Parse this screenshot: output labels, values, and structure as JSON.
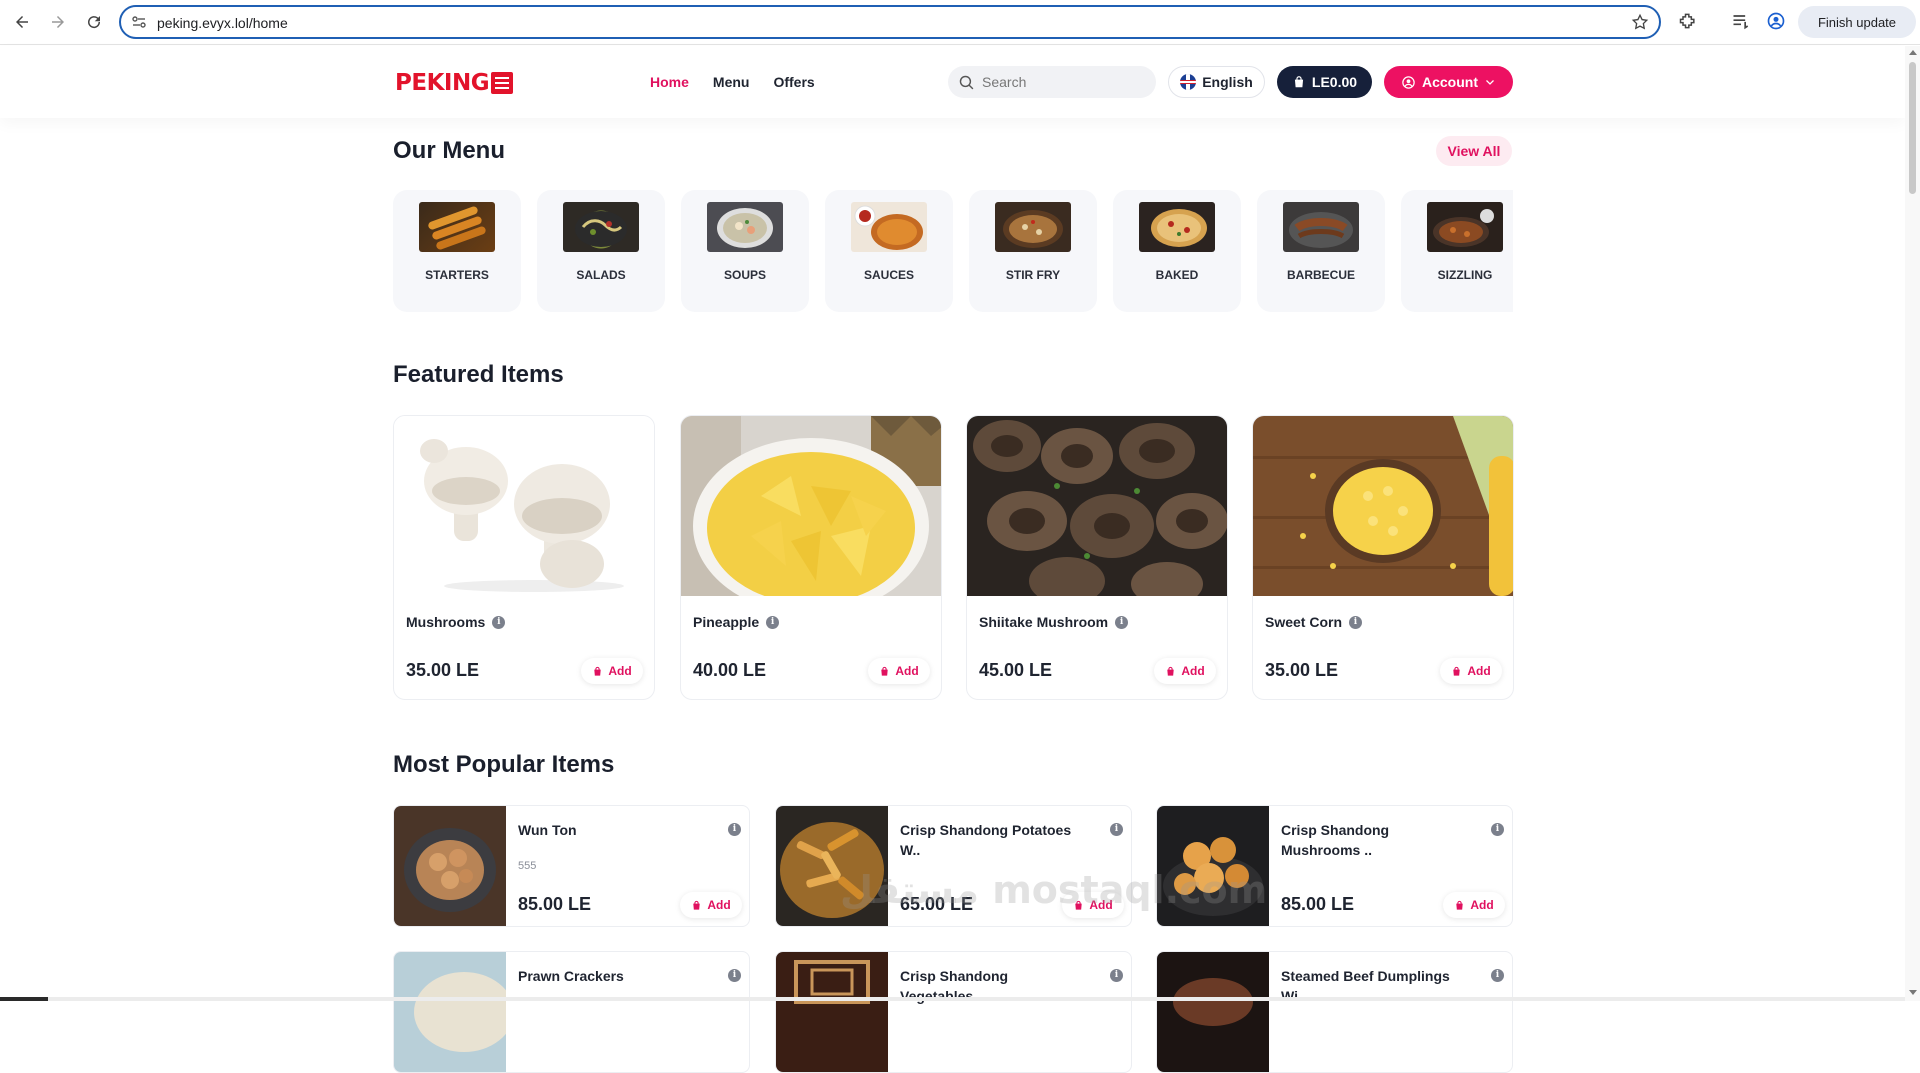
{
  "browser": {
    "url": "peking.evyx.lol/home",
    "finish_update": "Finish update"
  },
  "header": {
    "logo_text": "PEKING",
    "nav": [
      {
        "label": "Home",
        "active": true
      },
      {
        "label": "Menu",
        "active": false
      },
      {
        "label": "Offers",
        "active": false
      }
    ],
    "search_placeholder": "Search",
    "language": "English",
    "cart_total": "LE0.00",
    "account_label": "Account"
  },
  "menu_section": {
    "title": "Our Menu",
    "view_all": "View All",
    "categories": [
      "STARTERS",
      "SALADS",
      "SOUPS",
      "SAUCES",
      "STIR FRY",
      "BAKED",
      "BARBECUE",
      "SIZZLING"
    ]
  },
  "featured": {
    "title": "Featured Items",
    "items": [
      {
        "name": "Mushrooms",
        "price": "35.00 LE",
        "add": "Add"
      },
      {
        "name": "Pineapple",
        "price": "40.00 LE",
        "add": "Add"
      },
      {
        "name": "Shiitake Mushroom",
        "price": "45.00 LE",
        "add": "Add"
      },
      {
        "name": "Sweet Corn",
        "price": "35.00 LE",
        "add": "Add"
      }
    ]
  },
  "popular": {
    "title": "Most Popular Items",
    "items": [
      {
        "name": "Wun Ton",
        "desc": "555",
        "price": "85.00 LE",
        "add": "Add"
      },
      {
        "name": "Crisp Shandong Potatoes W..",
        "desc": "",
        "price": "65.00 LE",
        "add": "Add"
      },
      {
        "name": "Crisp Shandong Mushrooms ..",
        "desc": "",
        "price": "85.00 LE",
        "add": "Add"
      },
      {
        "name": "Prawn Crackers",
        "desc": "",
        "price": "",
        "add": ""
      },
      {
        "name": "Crisp Shandong Vegetables..",
        "desc": "",
        "price": "",
        "add": ""
      },
      {
        "name": "Steamed Beef Dumplings Wi..",
        "desc": "",
        "price": "",
        "add": ""
      }
    ]
  },
  "watermark": "مستقل mostaql.com",
  "colors": {
    "accent": "#e0115f",
    "brand_red": "#e2132b",
    "dark": "#16203a"
  },
  "icons": {
    "back": "arrow-left-icon",
    "forward": "arrow-right-icon",
    "reload": "reload-icon",
    "search": "search-icon",
    "cart": "shopping-bag-icon",
    "account": "user-circle-icon",
    "info": "info-icon"
  }
}
